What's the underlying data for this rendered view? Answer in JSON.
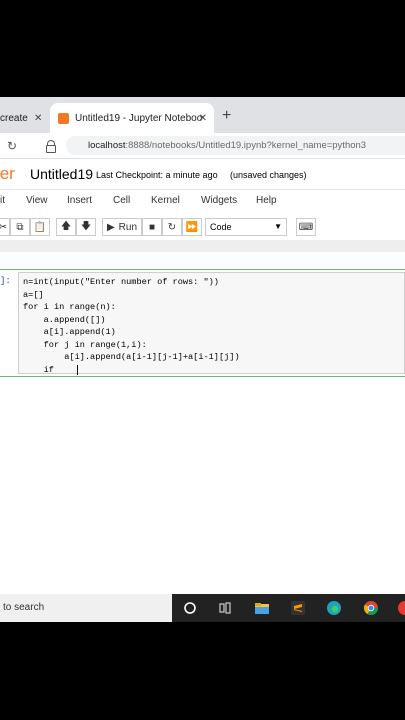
{
  "browser": {
    "tabs": [
      {
        "title": "create a",
        "active": false
      },
      {
        "title": "Untitled19 - Jupyter Notebook",
        "active": true
      }
    ],
    "url_host": "localhost",
    "url_path": ":8888/notebooks/Untitled19.ipynb?kernel_name=python3"
  },
  "jupyter": {
    "logo": "ter",
    "notebook_name": "Untitled19",
    "checkpoint": "Last Checkpoint: a minute ago",
    "unsaved": "(unsaved changes)",
    "menu": [
      "it",
      "View",
      "Insert",
      "Cell",
      "Kernel",
      "Widgets",
      "Help"
    ],
    "run_label": "Run",
    "cell_type": "Code",
    "prompt": "]:"
  },
  "code": {
    "lines": [
      "n=int(input(\"Enter number of rows: \"))",
      "a=[]",
      "for i in range(n):",
      "    a.append([])",
      "    a[i].append(1)",
      "    for j in range(1,i):",
      "        a[i].append(a[i-1][j-1]+a[i-1][j])",
      "    if"
    ]
  },
  "taskbar": {
    "search_text": "to search"
  },
  "colors": {
    "jupyter_orange": "#f37726",
    "cell_border": "#66bb6a",
    "prompt_blue": "#303f9f"
  }
}
